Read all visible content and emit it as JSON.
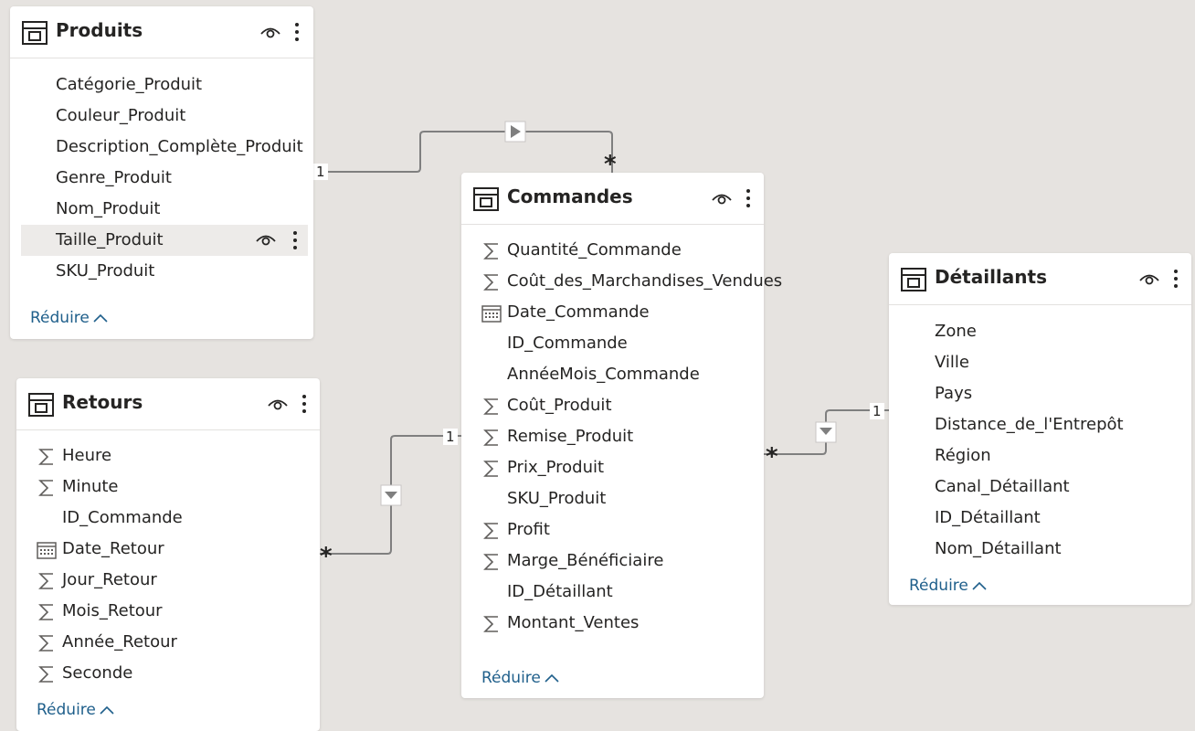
{
  "tables": {
    "produits": {
      "title": "Produits",
      "fields": [
        "Catégorie_Produit",
        "Couleur_Produit",
        "Description_Complète_Produit",
        "Genre_Produit",
        "Nom_Produit",
        "Taille_Produit",
        "SKU_Produit"
      ],
      "collapse_label": "Réduire"
    },
    "commandes": {
      "title": "Commandes",
      "fields": [
        "Quantité_Commande",
        "Coût_des_Marchandises_Vendues",
        "Date_Commande",
        "ID_Commande",
        "AnnéeMois_Commande",
        "Coût_Produit",
        "Remise_Produit",
        "Prix_Produit",
        "SKU_Produit",
        "Profit",
        "Marge_Bénéficiaire",
        "ID_Détaillant",
        "Montant_Ventes"
      ],
      "collapse_label": "Réduire"
    },
    "retours": {
      "title": "Retours",
      "fields": [
        "Heure",
        "Minute",
        "ID_Commande",
        "Date_Retour",
        "Jour_Retour",
        "Mois_Retour",
        "Année_Retour",
        "Seconde"
      ],
      "collapse_label": "Réduire"
    },
    "detaillants": {
      "title": "Détaillants",
      "fields": [
        "Zone",
        "Ville",
        "Pays",
        "Distance_de_l'Entrepôt",
        "Région",
        "Canal_Détaillant",
        "ID_Détaillant",
        "Nom_Détaillant"
      ],
      "collapse_label": "Réduire"
    }
  },
  "relationships": {
    "produits_commandes": {
      "one": "1",
      "many": "*"
    },
    "retours_commandes": {
      "one": "1",
      "many": "*"
    },
    "commandes_detaillants": {
      "one": "1",
      "many": "*"
    }
  },
  "colors": {
    "link": "#7a7a7a",
    "accent": "#1f5f8b",
    "background": "#e6e3e0"
  }
}
